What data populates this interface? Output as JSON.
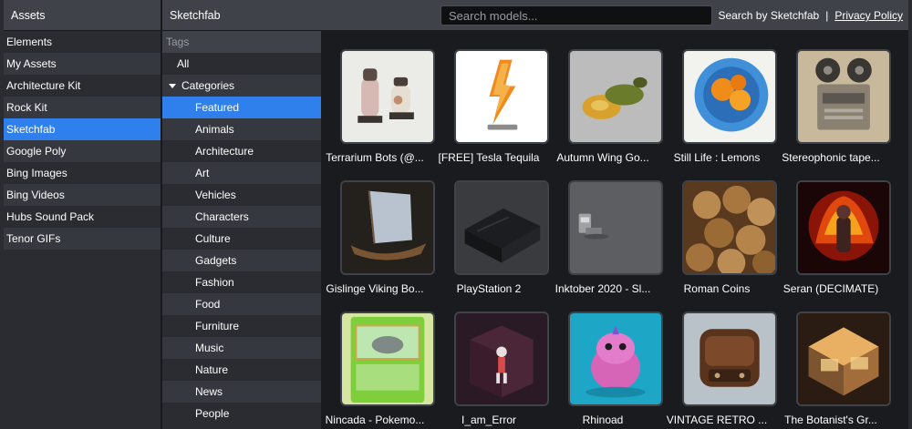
{
  "assets": {
    "title": "Assets",
    "items": [
      "Elements",
      "My Assets",
      "Architecture Kit",
      "Rock Kit",
      "Sketchfab",
      "Google Poly",
      "Bing Images",
      "Bing Videos",
      "Hubs Sound Pack",
      "Tenor GIFs"
    ],
    "active": "Sketchfab"
  },
  "topbar": {
    "title": "Sketchfab",
    "search_placeholder": "Search models...",
    "credit": "Search by Sketchfab",
    "separator": "|",
    "privacy_link": "Privacy Policy"
  },
  "tags": {
    "header": "Tags",
    "all": "All",
    "categories_label": "Categories",
    "categories": [
      "Featured",
      "Animals",
      "Architecture",
      "Art",
      "Vehicles",
      "Characters",
      "Culture",
      "Gadgets",
      "Fashion",
      "Food",
      "Furniture",
      "Music",
      "Nature",
      "News",
      "People"
    ],
    "active": "Featured"
  },
  "models": [
    {
      "title": "Terrarium Bots (@...",
      "thumb": "terrarium"
    },
    {
      "title": "[FREE] Tesla Tequila",
      "thumb": "tesla"
    },
    {
      "title": "Autumn Wing Go...",
      "thumb": "gourd"
    },
    {
      "title": "Still Life : Lemons",
      "thumb": "lemons"
    },
    {
      "title": "Stereophonic tape...",
      "thumb": "tape"
    },
    {
      "title": "Gislinge Viking Bo...",
      "thumb": "boat"
    },
    {
      "title": "PlayStation 2",
      "thumb": "ps2"
    },
    {
      "title": "Inktober 2020 - Sl...",
      "thumb": "inktober"
    },
    {
      "title": "Roman Coins",
      "thumb": "coins"
    },
    {
      "title": "Seran (DECIMATE)",
      "thumb": "seran"
    },
    {
      "title": "Nincada - Pokemo...",
      "thumb": "nincada"
    },
    {
      "title": "I_am_Error",
      "thumb": "error"
    },
    {
      "title": "Rhinoad",
      "thumb": "rhinoad"
    },
    {
      "title": "VINTAGE RETRO ...",
      "thumb": "radio"
    },
    {
      "title": "The Botanist's Gr...",
      "thumb": "botanist"
    }
  ]
}
